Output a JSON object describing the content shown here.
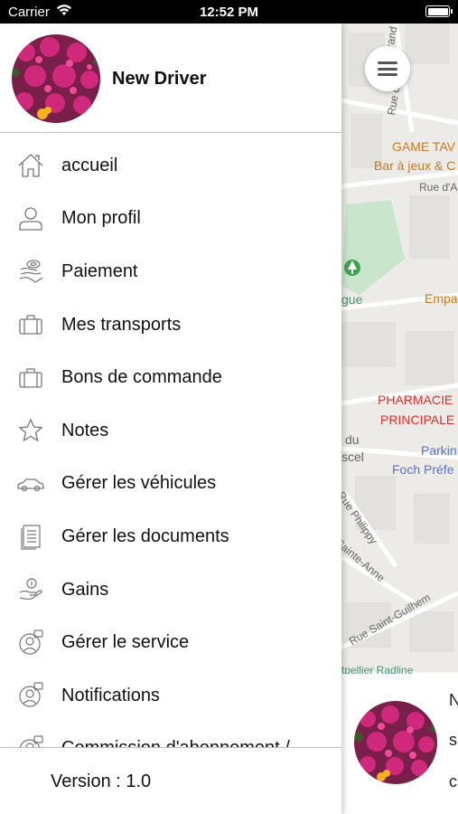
{
  "status_bar": {
    "carrier": "Carrier",
    "time": "12:52 PM"
  },
  "drawer": {
    "driver_name": "New Driver",
    "items": [
      {
        "label": "accueil",
        "icon": "home-icon"
      },
      {
        "label": "Mon profil",
        "icon": "person-icon"
      },
      {
        "label": "Paiement",
        "icon": "payment-hand-icon"
      },
      {
        "label": "Mes transports",
        "icon": "briefcase-icon"
      },
      {
        "label": "Bons de commande",
        "icon": "briefcase-icon"
      },
      {
        "label": "Notes",
        "icon": "star-icon"
      },
      {
        "label": "Gérer les véhicules",
        "icon": "car-icon"
      },
      {
        "label": "Gérer les documents",
        "icon": "document-icon"
      },
      {
        "label": "Gains",
        "icon": "earnings-hand-icon"
      },
      {
        "label": "Gérer le service",
        "icon": "service-agent-icon"
      },
      {
        "label": "Notifications",
        "icon": "notification-agent-icon"
      },
      {
        "label": "Commission d'abonnement /",
        "icon": "subscription-agent-icon"
      }
    ],
    "version": "Version : 1.0"
  },
  "map": {
    "labels": {
      "street_top": "Rue d",
      "street_grand": "Grand",
      "game": "GAME TAV",
      "bar": "Bar à jeux & C",
      "rue_da": "Rue d'A",
      "gue": "gue",
      "emp": "Empa",
      "pharmacie": "PHARMACIE",
      "principale": "PRINCIPALE",
      "du": "du",
      "scel": "scel",
      "parking": "Parkin",
      "foch": "Foch Préfe",
      "philippy": "Rue Philippy",
      "sainte_anne": "Sainte-Anne",
      "saint_guilhem": "Rue Saint-Guilhem",
      "montpellier": "tpellier Radline"
    }
  },
  "bottom_card": {
    "line1": "N",
    "line2": "s",
    "line3": "c"
  }
}
